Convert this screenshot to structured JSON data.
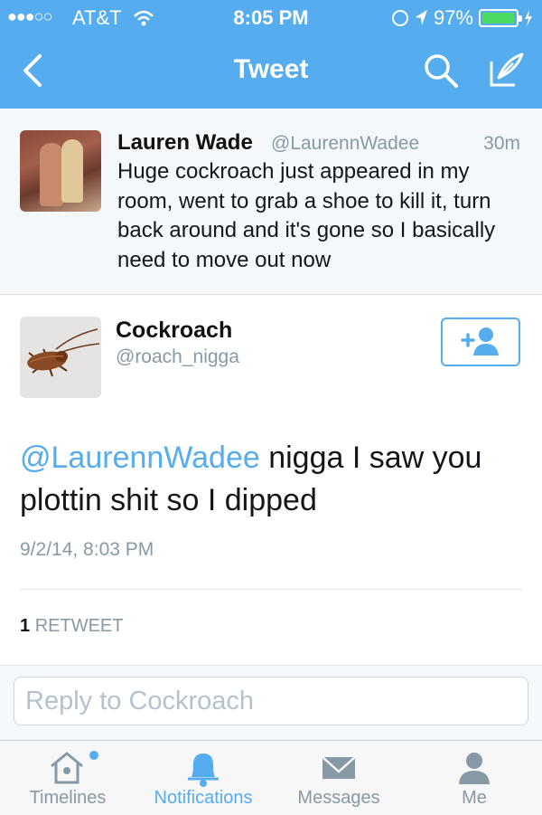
{
  "status_bar": {
    "signal": "●●●○○",
    "carrier": "AT&T",
    "time": "8:05 PM",
    "battery": "97%",
    "battery_level": 0.97
  },
  "nav": {
    "title": "Tweet",
    "icons": [
      "back-icon",
      "search-icon",
      "compose-icon"
    ]
  },
  "parent_tweet": {
    "name": "Lauren Wade",
    "handle": "@LaurennWadee",
    "time": "30m",
    "text": "Huge cockroach just appeared in my room, went to grab a shoe to kill it, turn back around and it's gone so I basically need to move out now"
  },
  "tweet": {
    "name": "Cockroach",
    "handle": "@roach_nigga",
    "mention": "@LaurennWadee",
    "body": " nigga I saw you plottin shit so I dipped",
    "date": "9/2/14, 8:03 PM",
    "retweet_count": "1",
    "retweet_label": "RETWEET"
  },
  "reply": {
    "placeholder": "Reply to Cockroach"
  },
  "tabs": [
    {
      "label": "Timelines",
      "icon": "home-icon"
    },
    {
      "label": "Notifications",
      "icon": "bell-icon"
    },
    {
      "label": "Messages",
      "icon": "envelope-icon"
    },
    {
      "label": "Me",
      "icon": "person-icon"
    }
  ],
  "colors": {
    "brand": "#55acee",
    "muted": "#8899a6",
    "battery": "#4cd964"
  }
}
